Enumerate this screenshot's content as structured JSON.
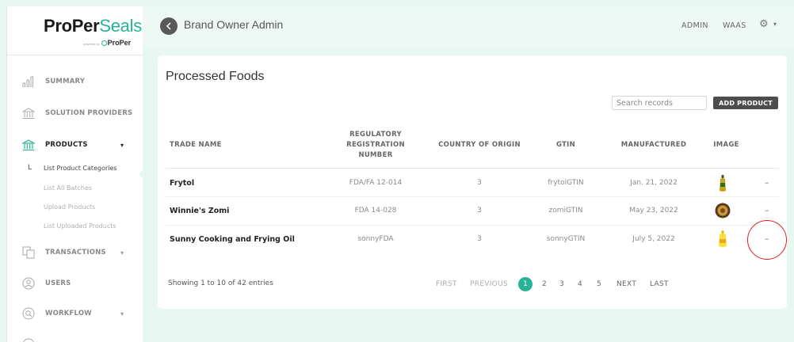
{
  "brand": {
    "name_part1": "ProPer",
    "name_part2": "Seals",
    "sub_small": "powered by",
    "sub_brand": "ProPer"
  },
  "sidebar": {
    "items": [
      {
        "label": "SUMMARY",
        "icon": "bar-chart-icon"
      },
      {
        "label": "SOLUTION PROVIDERS",
        "icon": "bank-icon"
      },
      {
        "label": "PRODUCTS",
        "icon": "bank-icon",
        "caret": "▾"
      },
      {
        "label": "TRANSACTIONS",
        "icon": "transactions-icon",
        "caret": "▾"
      },
      {
        "label": "USERS",
        "icon": "user-icon"
      },
      {
        "label": "WORKFLOW",
        "icon": "workflow-icon",
        "caret": "▾"
      }
    ],
    "subitems": [
      {
        "label": "List Product Categories",
        "bullet": "L"
      },
      {
        "label": "List All Batches"
      },
      {
        "label": "Upload Products"
      },
      {
        "label": "List Uploaded Products"
      }
    ]
  },
  "topbar": {
    "back_icon": "chevron-left-icon",
    "title": "Brand Owner Admin",
    "admin": "ADMIN",
    "waas": "WAAS",
    "settings_icon": "gear-icon",
    "settings_caret": "▾"
  },
  "page": {
    "title": "Processed Foods",
    "search_placeholder": "Search records",
    "add_button": "ADD PRODUCT"
  },
  "table": {
    "headers": {
      "trade_name": "TRADE NAME",
      "reg_line1": "REGULATORY",
      "reg_line2": "REGISTRATION",
      "reg_line3": "NUMBER",
      "country": "COUNTRY OF ORIGIN",
      "gtin": "GTIN",
      "manufactured": "MANUFACTURED",
      "image": "IMAGE"
    },
    "rows": [
      {
        "trade_name": "Frytol",
        "reg": "FDA/FA 12-014",
        "country": "3",
        "gtin": "frytolGTIN",
        "manufactured": "Jan. 21, 2022",
        "image": "oil-bottle-image",
        "action": "–"
      },
      {
        "trade_name": "Winnie's Zomi",
        "reg": "FDA 14-028",
        "country": "3",
        "gtin": "zomiGTIN",
        "manufactured": "May 23, 2022",
        "image": "zomi-jar-image",
        "action": "–"
      },
      {
        "trade_name": "Sunny Cooking and Frying Oil",
        "reg": "sonnyFDA",
        "country": "3",
        "gtin": "sonnyGTIN",
        "manufactured": "July 5, 2022",
        "image": "sunny-oil-image",
        "action": "–"
      }
    ]
  },
  "pagination": {
    "showing": "Showing 1 to 10 of 42 entries",
    "first": "FIRST",
    "previous": "PREVIOUS",
    "current": "1",
    "pages": [
      "2",
      "3",
      "4",
      "5"
    ],
    "next": "NEXT",
    "last": "LAST"
  },
  "colors": {
    "accent": "#27b398",
    "background": "#e9f7f3",
    "dark_button": "#4d4d4d",
    "annotation": "#e02020"
  }
}
